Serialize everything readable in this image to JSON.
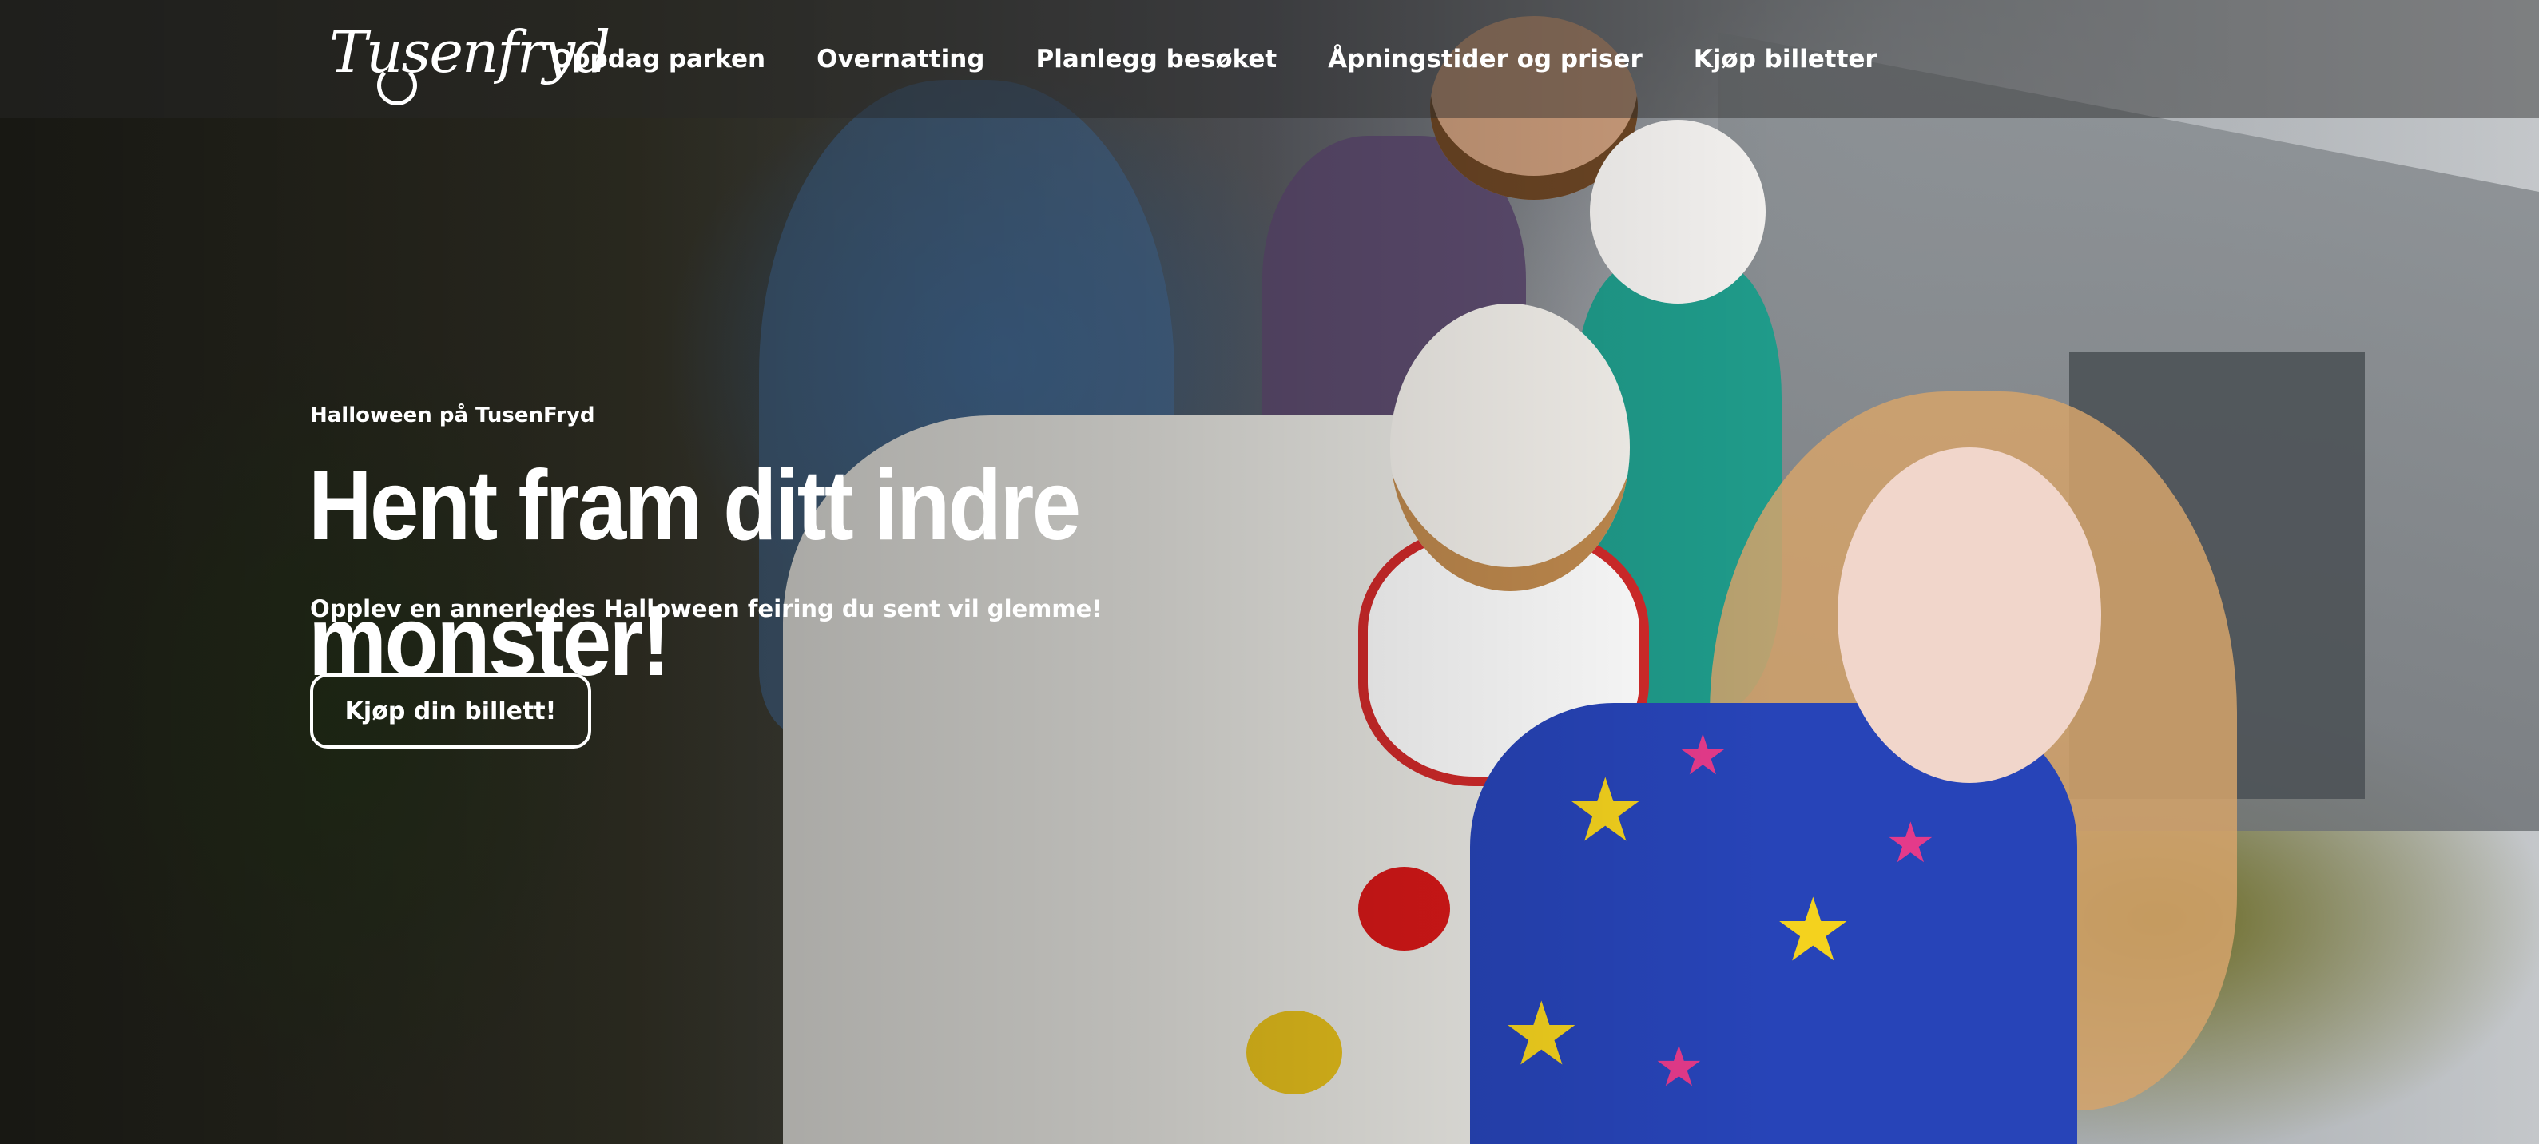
{
  "brand": {
    "logo_text": "Tusenfryd"
  },
  "nav": {
    "items": [
      {
        "label": "Oppdag parken"
      },
      {
        "label": "Overnatting"
      },
      {
        "label": "Planlegg besøket"
      },
      {
        "label": "Åpningstider og priser"
      },
      {
        "label": "Kjøp billetter"
      }
    ]
  },
  "hero": {
    "eyebrow": "Halloween på TusenFryd",
    "headline": "Hent fram ditt indre monster!",
    "subline": "Opplev en annerledes Halloween feiring du sent vil glemme!",
    "cta_label": "Kjøp din billett!"
  },
  "colors": {
    "nav_overlay": "#282828",
    "text": "#ffffff",
    "clown_red": "#d22a2a",
    "costume_blue": "#2744b8",
    "star_yellow": "#f4d21e"
  }
}
